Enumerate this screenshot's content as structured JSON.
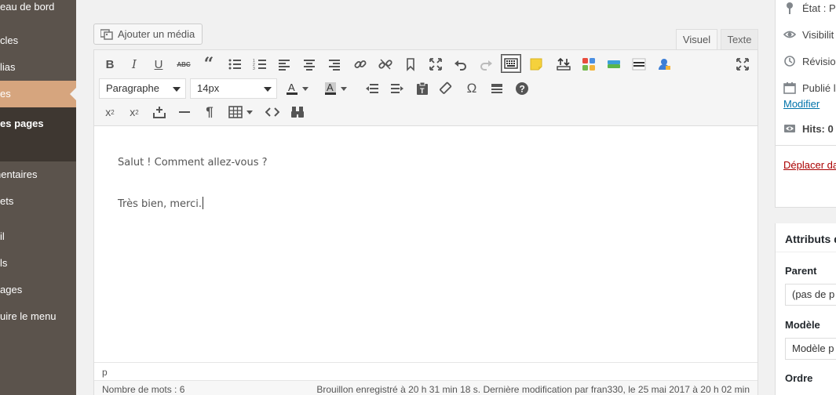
{
  "sidebar": {
    "items": [
      {
        "label": "eau de bord"
      },
      {
        "label": "cles"
      },
      {
        "label": "lias"
      },
      {
        "label": "es"
      },
      {
        "label": "es pages"
      },
      {
        "label": "nentaires"
      },
      {
        "label": "ets"
      },
      {
        "label": "il"
      },
      {
        "label": "ls"
      },
      {
        "label": "ages"
      },
      {
        "label": "uire le menu"
      }
    ]
  },
  "editor": {
    "add_media_label": "Ajouter un média",
    "tabs": {
      "visual": "Visuel",
      "text": "Texte"
    },
    "format_select": "Paragraphe",
    "size_select": "14px",
    "content": {
      "line1": "Salut ! Comment allez-vous ?",
      "line2": "Très bien, merci."
    },
    "path": "p",
    "word_count": "Nombre de mots : 6",
    "autosave": "Brouillon enregistré à 20 h 31 min 18 s. Dernière modification par fran330, le 25 mai 2017 à 20 h 02 min",
    "toolbar_icons": [
      "bold-icon",
      "italic-icon",
      "underline-icon",
      "strikethrough-icon",
      "blockquote-icon",
      "bullet-list-icon",
      "numbered-list-icon",
      "align-left-icon",
      "align-center-icon",
      "align-right-icon",
      "link-icon",
      "unlink-icon",
      "read-more-icon",
      "fullscreen-icon",
      "undo-icon",
      "redo-icon",
      "toolbar-toggle-icon",
      "sticky-note-icon"
    ]
  },
  "publish": {
    "status": "État : Pu",
    "visibility": "Visibilit",
    "revisions": "Révision",
    "published": "Publié l",
    "modify_link": "Modifier",
    "hits": "Hits: 0",
    "trash_link": "Déplacer da"
  },
  "attributes": {
    "title": "Attributs d",
    "parent_label": "Parent",
    "parent_value": "(pas de p",
    "template_label": "Modèle",
    "template_value": "Modèle p",
    "order_label": "Ordre"
  },
  "colors": {
    "sidebar_bg": "#5b534c",
    "sidebar_current": "#d6a57e",
    "link": "#0073aa",
    "trash": "#a00"
  }
}
